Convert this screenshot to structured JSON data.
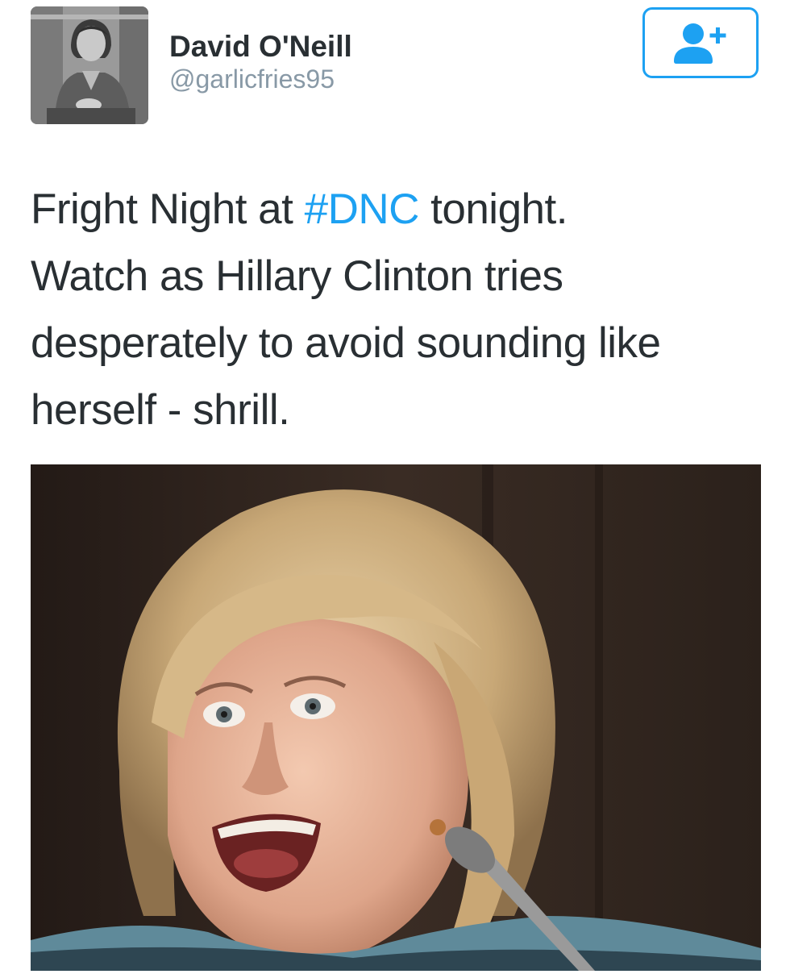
{
  "user": {
    "display_name": "David O'Neill",
    "handle": "@garlicfries95",
    "avatar_icon": "profile-photo"
  },
  "follow_button": {
    "icon": "add-user-icon",
    "color": "#1da1f2"
  },
  "tweet": {
    "line1_before": "Fright Night at ",
    "hashtag": "#DNC",
    "line1_after": " tonight.",
    "line2": "Watch as Hillary Clinton tries",
    "line3": "desperately to avoid sounding like",
    "line4": "herself - shrill."
  },
  "media": {
    "icon": "photo-woman-speaking-at-microphone"
  },
  "colors": {
    "text": "#292f33",
    "handle": "#8899a6",
    "link": "#1da1f2",
    "background": "#ffffff"
  }
}
